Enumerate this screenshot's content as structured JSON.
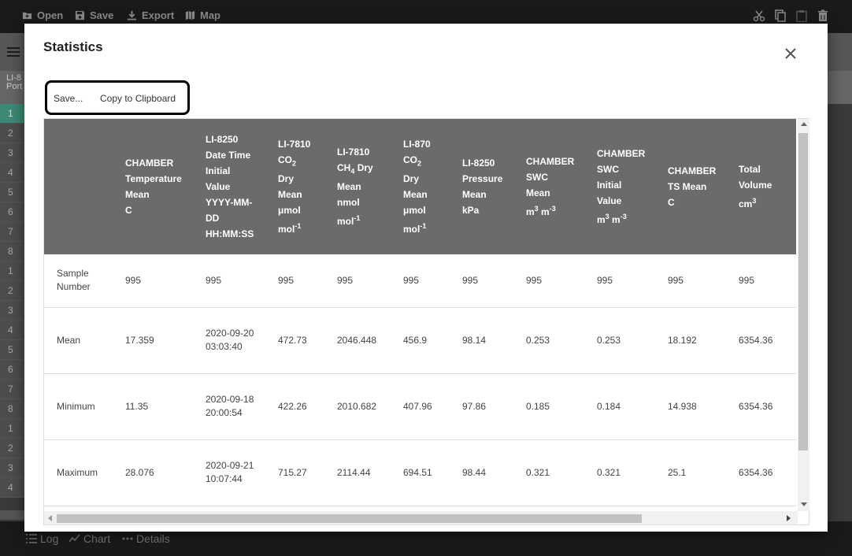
{
  "toolbar": {
    "open": "Open",
    "save": "Save",
    "export": "Export",
    "map": "Map"
  },
  "side": {
    "head_line1": "LI-8",
    "head_line2": "Port",
    "rows": [
      "1",
      "2",
      "3",
      "4",
      "5",
      "6",
      "7",
      "8",
      "1",
      "2",
      "3",
      "4",
      "5",
      "6",
      "7",
      "8",
      "1",
      "2",
      "3",
      "4"
    ]
  },
  "bottom": {
    "log": "Log",
    "chart": "Chart",
    "details": "Details"
  },
  "modal": {
    "title": "Statistics",
    "save_label": "Save...",
    "copy_label": "Copy to Clipboard"
  },
  "table": {
    "headers": [
      [],
      [
        "CHAMBER",
        "Temperature",
        "Mean",
        "C"
      ],
      [
        "LI-8250",
        "Date Time",
        "Initial",
        "Value",
        "YYYY-MM-",
        "DD",
        "HH:MM:SS"
      ],
      [
        "LI-7810",
        "CO2",
        "Dry",
        "Mean",
        "μmol",
        "mol-1"
      ],
      [
        "LI-7810",
        "CH4 Dry",
        "Mean",
        "nmol",
        "mol-1"
      ],
      [
        "LI-870",
        "CO2",
        "Dry",
        "Mean",
        "μmol",
        "mol-1"
      ],
      [
        "LI-8250",
        "Pressure",
        "Mean",
        "kPa"
      ],
      [
        "CHAMBER",
        "SWC",
        "Mean",
        "m3 m-3"
      ],
      [
        "CHAMBER",
        "SWC",
        "Initial",
        "Value",
        "m3 m-3"
      ],
      [
        "CHAMBER",
        "TS Mean",
        "C"
      ],
      [
        "Total",
        "Volume",
        "cm3"
      ]
    ],
    "rows": [
      [
        "Sample Number",
        "995",
        "995",
        "995",
        "995",
        "995",
        "995",
        "995",
        "995",
        "995",
        "995"
      ],
      [
        "Mean",
        "17.359",
        "2020-09-20 03:03:40",
        "472.73",
        "2046.448",
        "456.9",
        "98.14",
        "0.253",
        "0.253",
        "18.192",
        "6354.36"
      ],
      [
        "Minimum",
        "11.35",
        "2020-09-18 20:00:54",
        "422.26",
        "2010.682",
        "407.96",
        "97.86",
        "0.185",
        "0.184",
        "14.938",
        "6354.36"
      ],
      [
        "Maximum",
        "28.076",
        "2020-09-21 10:07:44",
        "715.27",
        "2114.44",
        "694.51",
        "98.44",
        "0.321",
        "0.321",
        "25.1",
        "6354.36"
      ]
    ]
  },
  "colors": {
    "header_bg": "#6b6b6b",
    "selected_row": "#3c8a76",
    "topbar_bg": "#1a1a1a"
  }
}
